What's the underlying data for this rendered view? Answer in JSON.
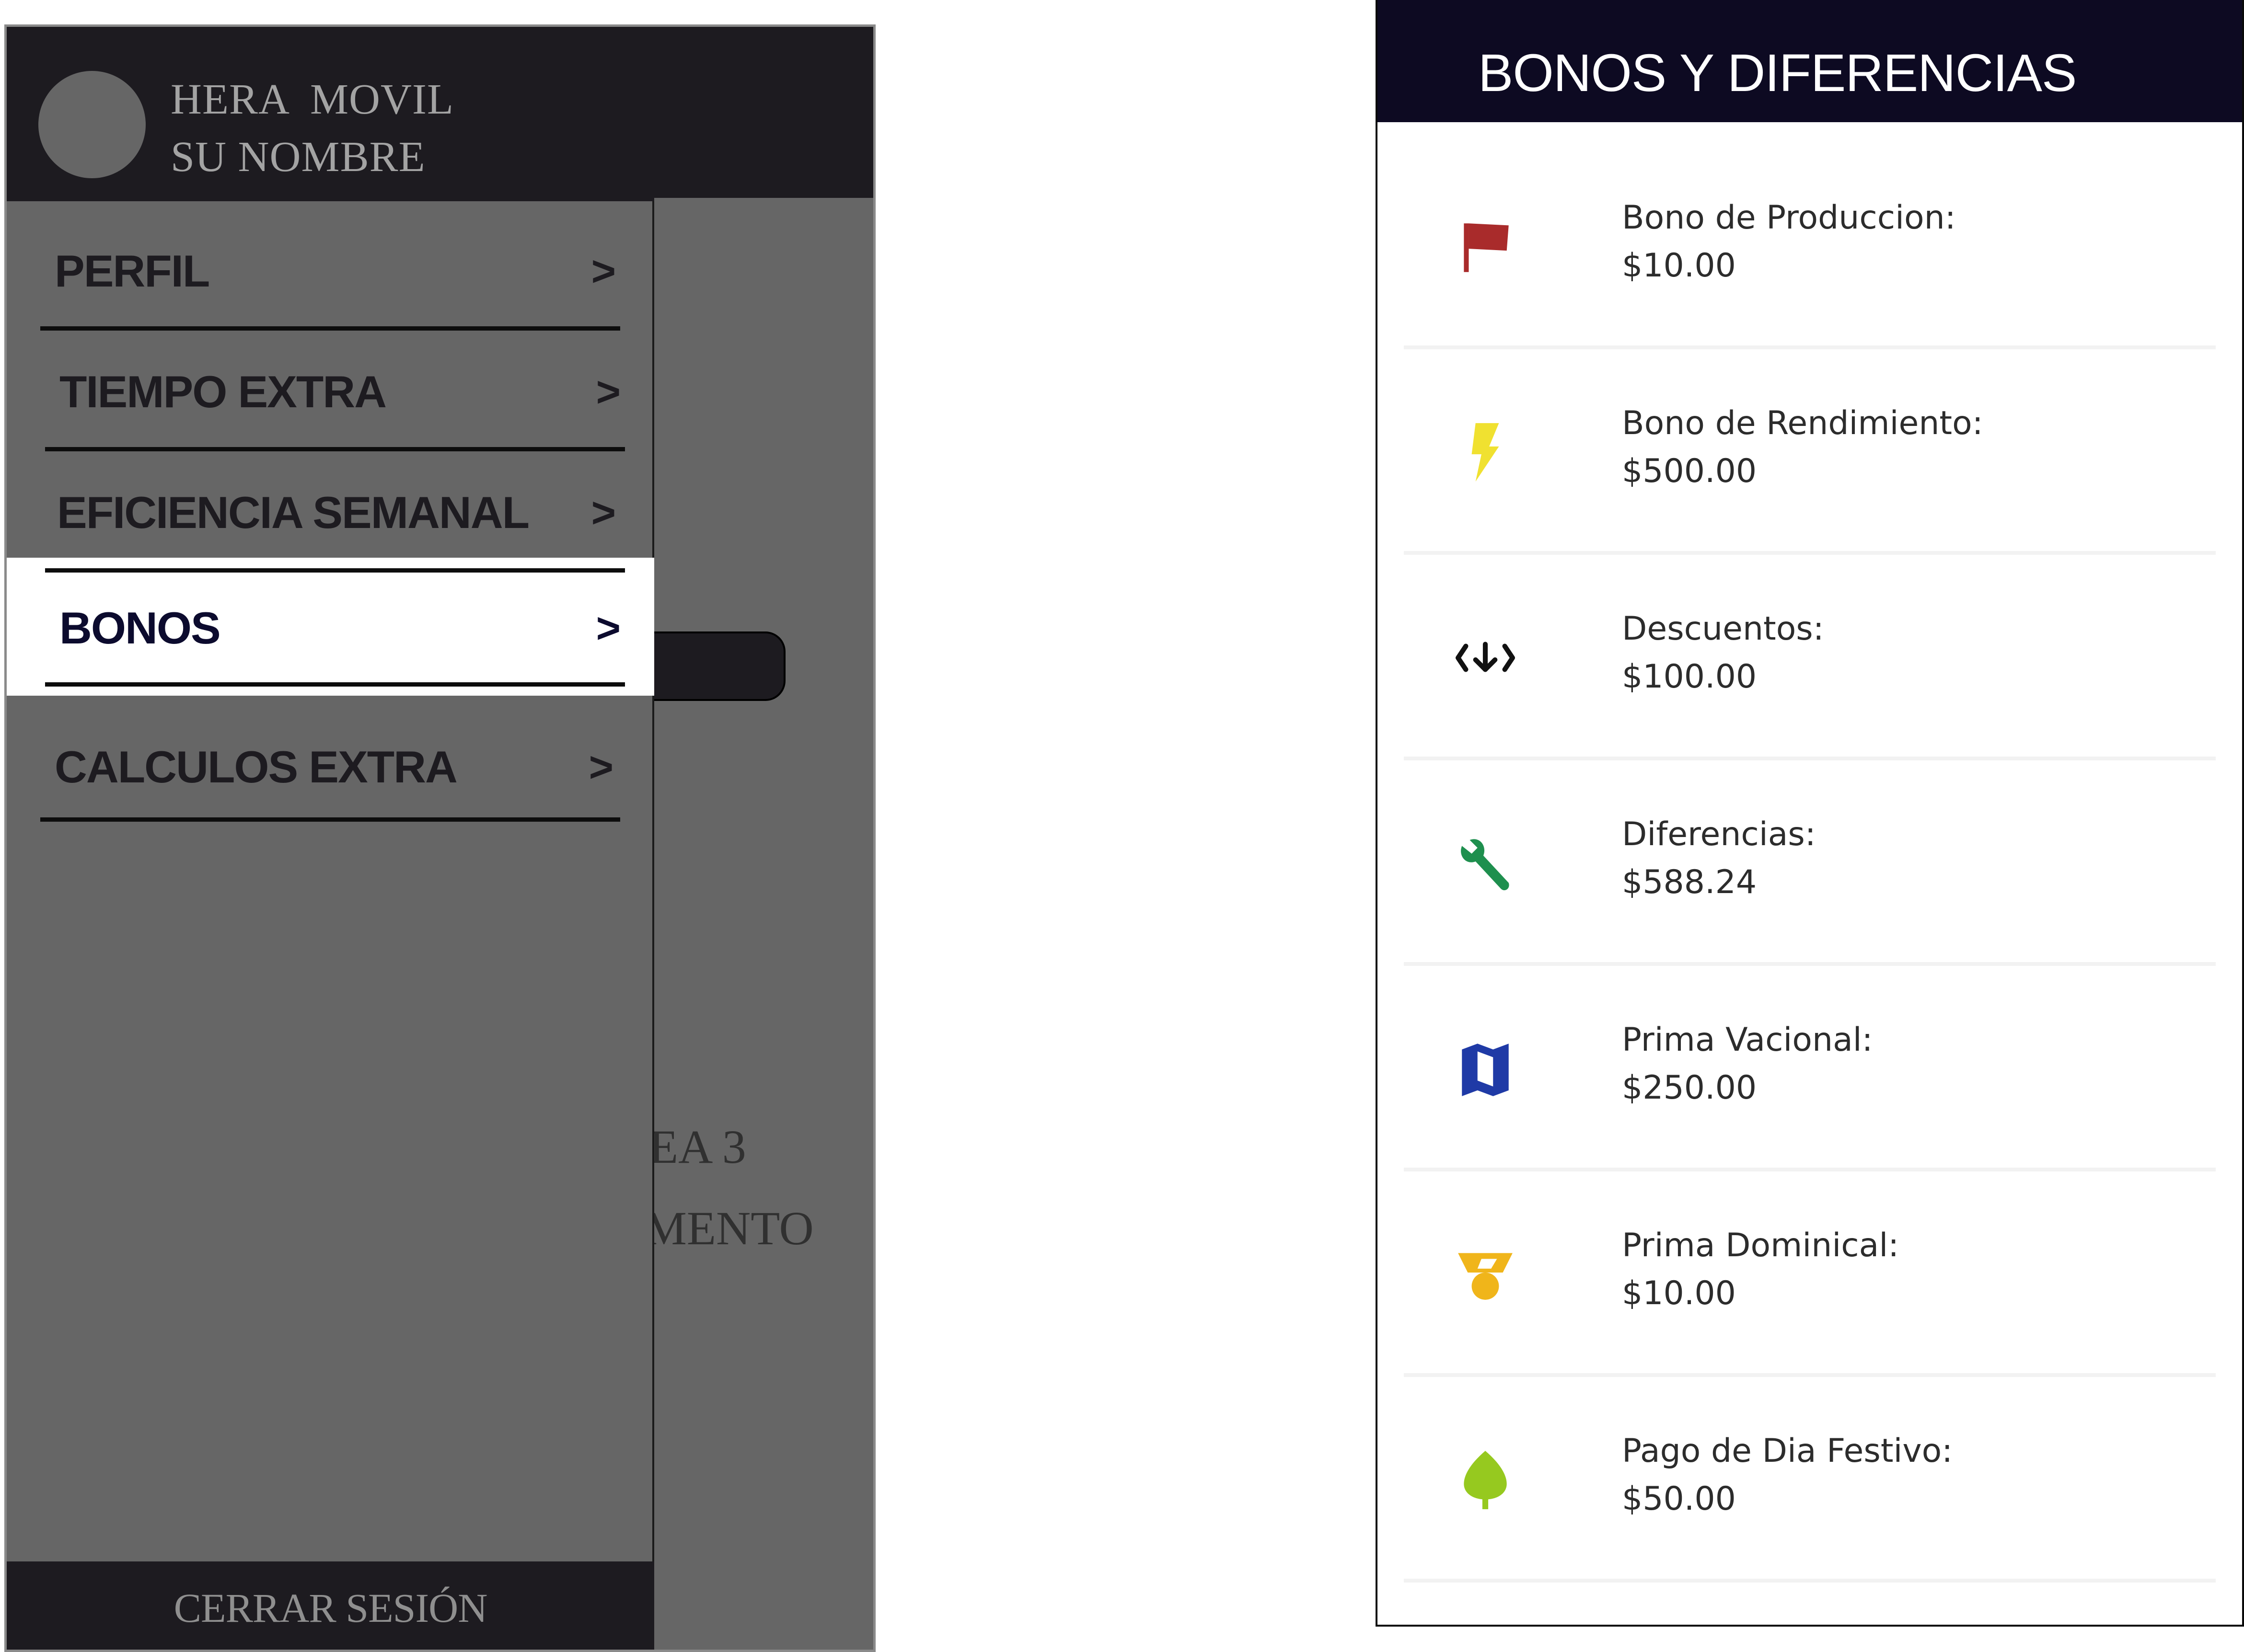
{
  "drawer": {
    "app_name": "HERA  MOVIL",
    "user_name": "SU NOMBRE",
    "items": [
      {
        "label": "PERFIL",
        "chevron": ">"
      },
      {
        "label": "TIEMPO EXTRA",
        "chevron": ">"
      },
      {
        "label": "EFICIENCIA SEMANAL",
        "chevron": ">"
      },
      {
        "label": "BONOS",
        "chevron": ">",
        "selected": true
      },
      {
        "label": "CALCULOS EXTRA",
        "chevron": ">"
      }
    ],
    "logout_label": "CERRAR SESIÓN"
  },
  "background_screen": {
    "visible_text_1": "EA 3",
    "visible_text_2": "MENTO"
  },
  "bonos_screen": {
    "title": "BONOS Y DIFERENCIAS",
    "rows": [
      {
        "name": "Bono de Produccion:",
        "amount": "$10.00",
        "icon": "flag-icon",
        "color": "#a92b2b"
      },
      {
        "name": "Bono de Rendimiento:",
        "amount": "$500.00",
        "icon": "lightning-icon",
        "color": "#f0e130"
      },
      {
        "name": "Descuentos:",
        "amount": "$100.00",
        "icon": "download-arrows-icon",
        "color": "#111111"
      },
      {
        "name": "Diferencias:",
        "amount": "$588.24",
        "icon": "wrench-icon",
        "color": "#1e8f4e"
      },
      {
        "name": "Prima Vacional:",
        "amount": "$250.00",
        "icon": "map-icon",
        "color": "#1f3aa6"
      },
      {
        "name": "Prima Dominical:",
        "amount": "$10.00",
        "icon": "medal-icon",
        "color": "#f0b51a"
      },
      {
        "name": "Pago de Dia Festivo:",
        "amount": "$50.00",
        "icon": "leaf-icon",
        "color": "#96c91f"
      }
    ]
  },
  "colors": {
    "drawer_bg": "#666666",
    "header_bg": "#1d1b20",
    "top_bar_bg": "#0d0a22",
    "selected_item_bg": "#ffffff"
  }
}
